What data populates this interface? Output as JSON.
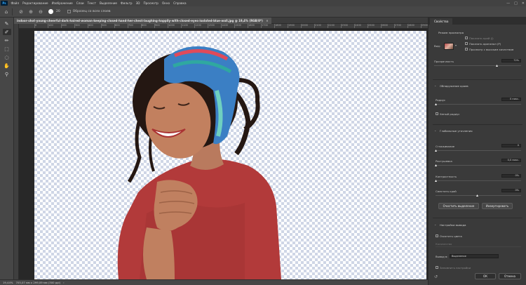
{
  "menu": {
    "logo": "Ps",
    "items": [
      "Файл",
      "Редактирование",
      "Изображение",
      "Слои",
      "Текст",
      "Выделение",
      "Фильтр",
      "3D",
      "Просмотр",
      "Окно",
      "Справка"
    ],
    "window_controls": [
      "—",
      "□",
      "✕"
    ]
  },
  "options": {
    "brush_size": "20",
    "sample_all_layers": "Образец со всех слоев"
  },
  "document": {
    "tab_title": "indoor-shot-young-cheerful-dark-haired-woman-keeping-closed-hand-her-chest-laughing-happily-with-closed-eyes-isolated-blue-wall.jpg @ 19,4% (RGB/8*)",
    "close": "×"
  },
  "ruler": {
    "labels": [
      "0",
      "100",
      "200",
      "300",
      "400",
      "500",
      "600",
      "700",
      "800",
      "900",
      "1000",
      "1100",
      "1200",
      "1300",
      "1400",
      "1500",
      "1600",
      "1700",
      "1800",
      "1900",
      "2000",
      "2100",
      "2200",
      "2300",
      "2400",
      "2500",
      "2600",
      "2700",
      "2800",
      "2900",
      "3000"
    ]
  },
  "status": {
    "zoom": "19,44%",
    "size": "705,07 мм x 299,09 мм (300 ppi)",
    "arrow": "›"
  },
  "panel": {
    "tab": "Свойства",
    "view_mode_section": "Режим просмотра",
    "view_label": "Вид:",
    "show_edge": "Показать край (J)",
    "show_original": "Показать оригинал (P)",
    "high_quality_preview": "Просмотр с высоким качеством",
    "opacity_label": "Прозрачность",
    "opacity_value": "72%",
    "edge_detection_section": "Обнаружение краев",
    "radius_label": "Радиус",
    "radius_value": "0 пикс.",
    "smart_radius": "Умный радиус",
    "global_refinements_section": "Глобальные уточнения",
    "smooth_label": "Сглаживание",
    "smooth_value": "0",
    "feather_label": "Растушевка",
    "feather_value": "0,0 пикс.",
    "contrast_label": "Контрастность",
    "contrast_value": "0%",
    "shift_edge_label": "Сместить край",
    "shift_edge_value": "0%",
    "clear_selection": "Очистить выделение",
    "invert": "Инвертировать",
    "output_settings_section": "Настройки вывода",
    "decontaminate": "Очистить цвета",
    "amount_label": "Количество",
    "output_to_label": "Вывод в:",
    "output_to_value": "Выделение",
    "remember_settings": "Запомнить настройки",
    "ok": "ОК",
    "cancel": "Отмена"
  }
}
